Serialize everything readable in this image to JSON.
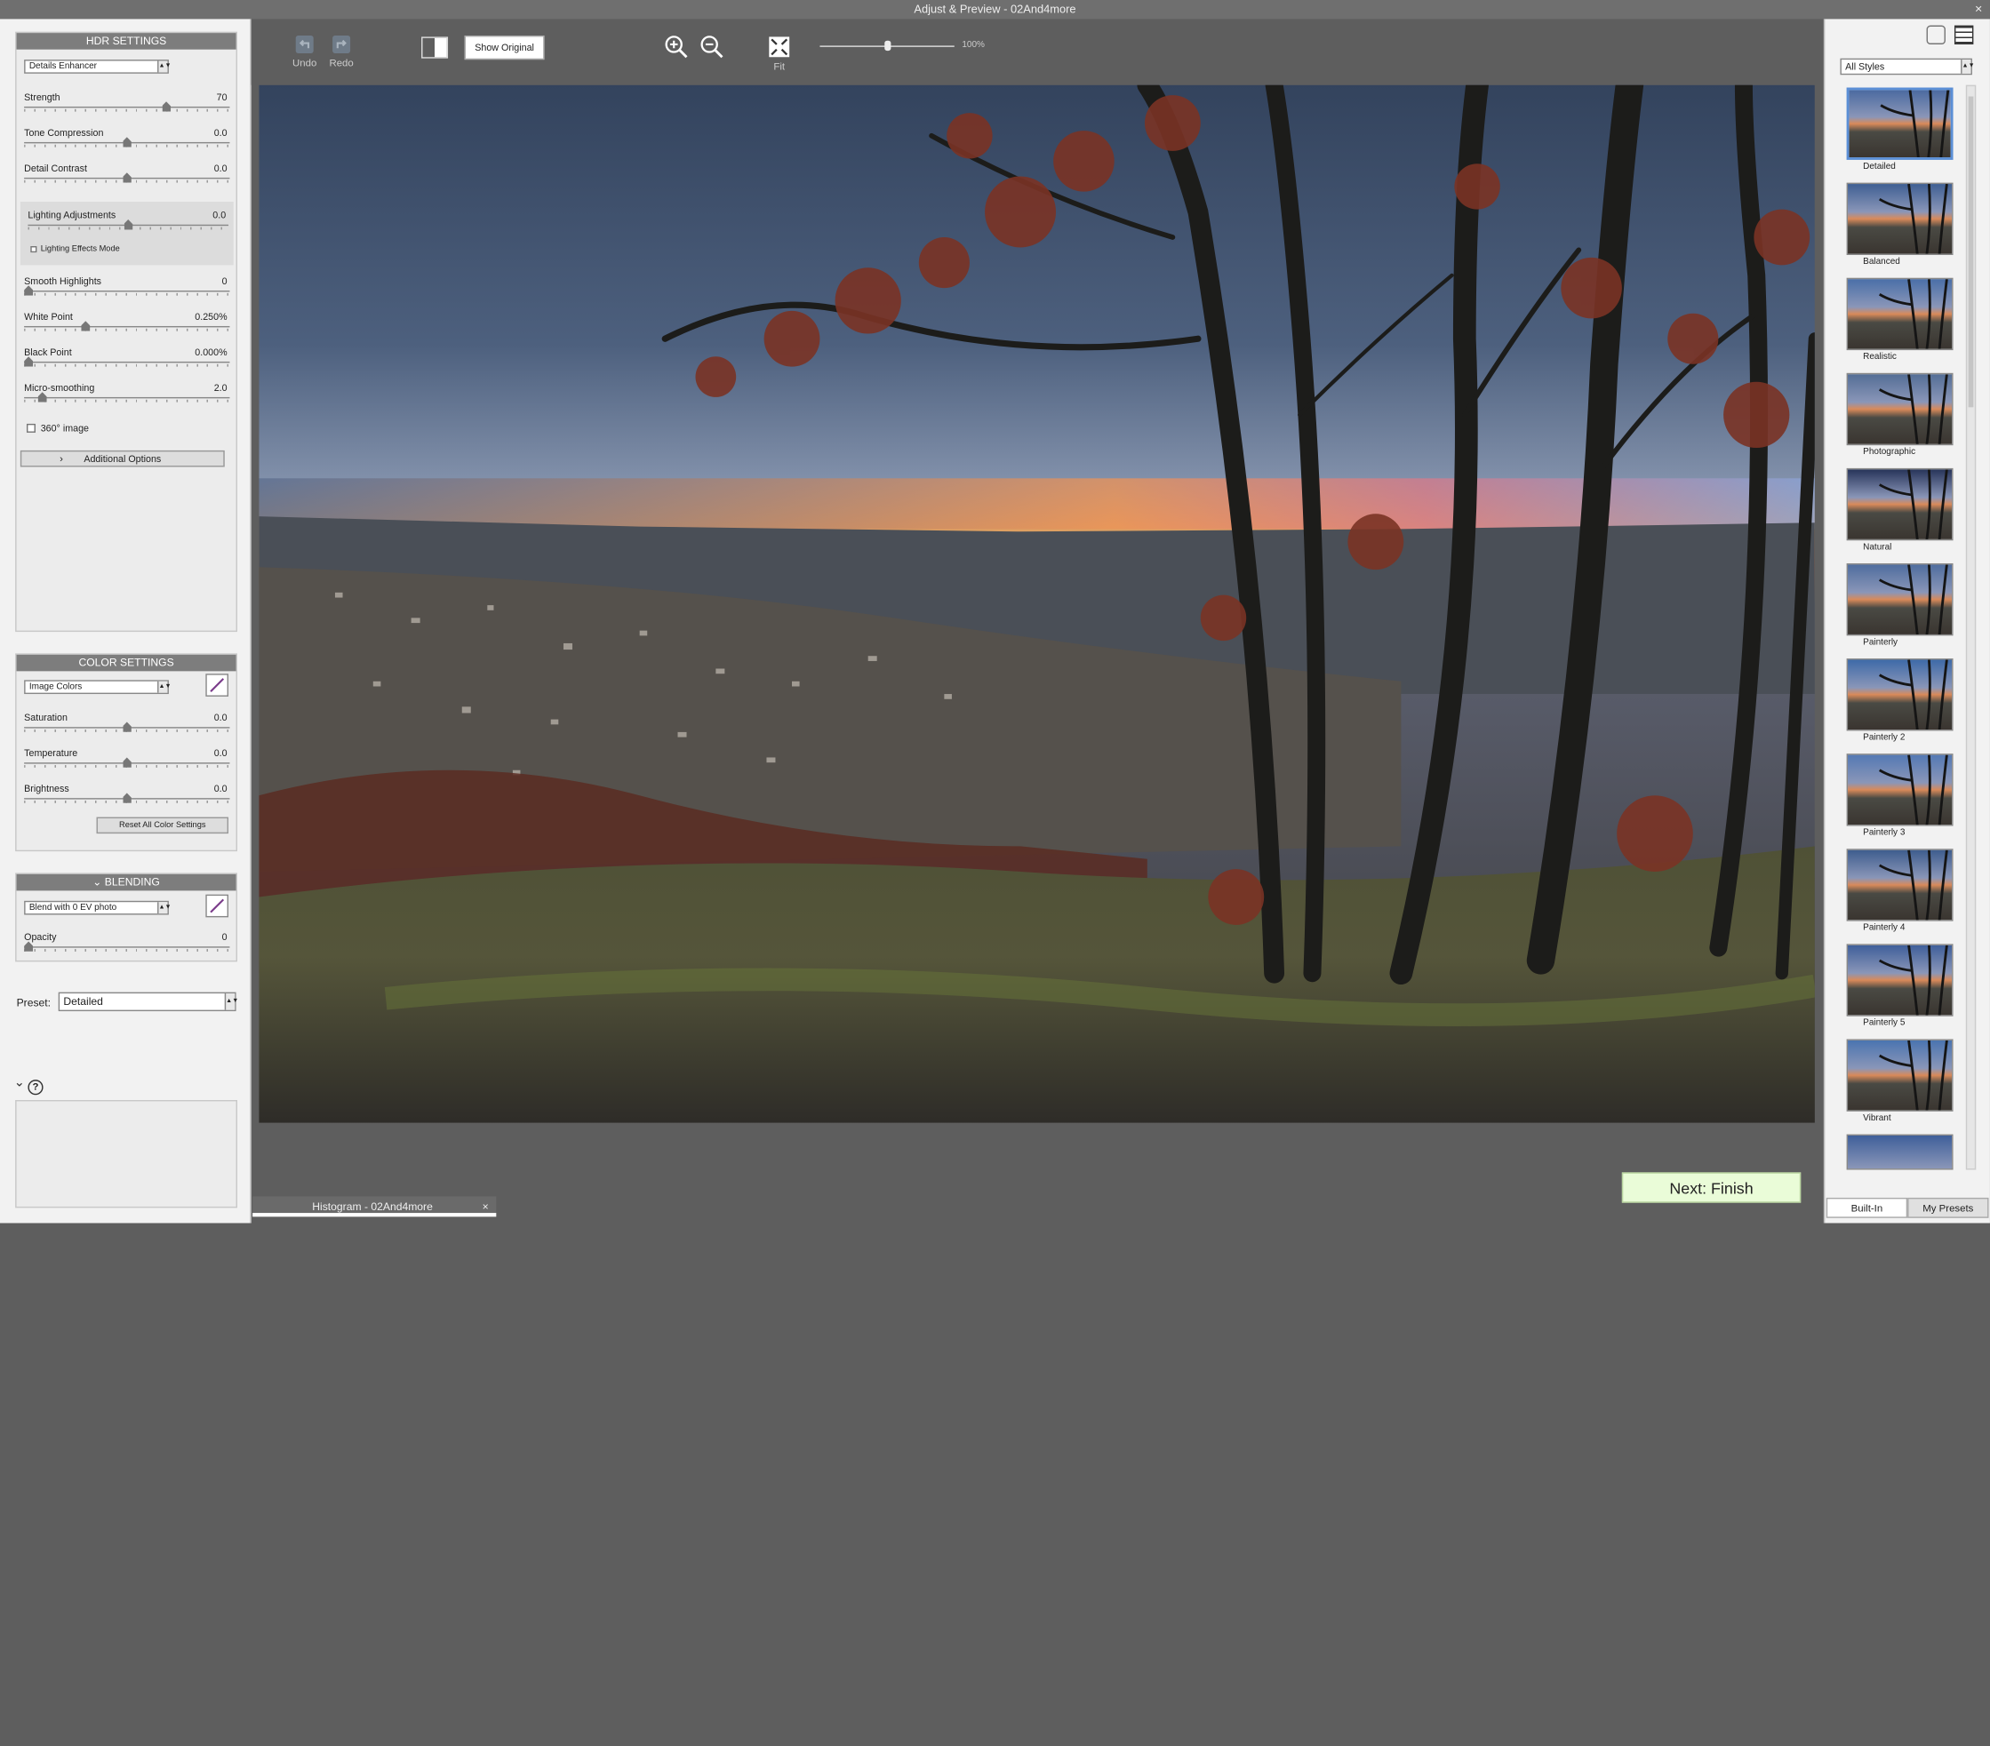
{
  "window": {
    "title": "Adjust & Preview - 02And4more",
    "close": "×"
  },
  "hdr": {
    "heading": "HDR SETTINGS",
    "mode": "Details Enhancer",
    "sliders": [
      {
        "label": "Strength",
        "value": "70",
        "pos": 0.7
      },
      {
        "label": "Tone Compression",
        "value": "0.0",
        "pos": 0.5
      },
      {
        "label": "Detail Contrast",
        "value": "0.0",
        "pos": 0.5
      }
    ],
    "lighting": {
      "label": "Lighting Adjustments",
      "value": "0.0",
      "pos": 0.5,
      "effects_mode": "Lighting Effects Mode"
    },
    "sliders2": [
      {
        "label": "Smooth Highlights",
        "value": "0",
        "pos": 0.0
      },
      {
        "label": "White Point",
        "value": "0.250%",
        "pos": 0.29
      },
      {
        "label": "Black Point",
        "value": "0.000%",
        "pos": 0.0
      },
      {
        "label": "Micro-smoothing",
        "value": "2.0",
        "pos": 0.07
      }
    ],
    "image360": "360° image",
    "additional": "Additional Options"
  },
  "color": {
    "heading": "COLOR SETTINGS",
    "mode": "Image Colors",
    "sliders": [
      {
        "label": "Saturation",
        "value": "0.0",
        "pos": 0.5
      },
      {
        "label": "Temperature",
        "value": "0.0",
        "pos": 0.5
      },
      {
        "label": "Brightness",
        "value": "0.0",
        "pos": 0.5
      }
    ],
    "reset": "Reset All Color Settings"
  },
  "blending": {
    "heading": "BLENDING",
    "mode": "Blend with 0 EV photo",
    "opacity": {
      "label": "Opacity",
      "value": "0",
      "pos": 0.0
    }
  },
  "preset": {
    "label": "Preset:",
    "value": "Detailed"
  },
  "help": {
    "icon": "?"
  },
  "toolbar": {
    "undo": "Undo",
    "redo": "Redo",
    "show_original": "Show Original",
    "fit": "Fit",
    "zoom": "100%",
    "zoom_level": 0.5
  },
  "styles": {
    "filter": "All Styles",
    "items": [
      "Detailed",
      "Balanced",
      "Realistic",
      "Photographic",
      "Natural",
      "Painterly",
      "Painterly 2",
      "Painterly 3",
      "Painterly 4",
      "Painterly 5",
      "Vibrant"
    ],
    "selected": "Detailed",
    "tabs": [
      "Built-In",
      "My Presets"
    ]
  },
  "finish": "Next: Finish",
  "histogram": {
    "title": "Histogram - 02And4more",
    "close": "×"
  },
  "colors": {
    "header": "#7d7d7d",
    "finish_bg": "#eafcd8",
    "panel": "#ececec",
    "background": "#5e5e5e"
  }
}
